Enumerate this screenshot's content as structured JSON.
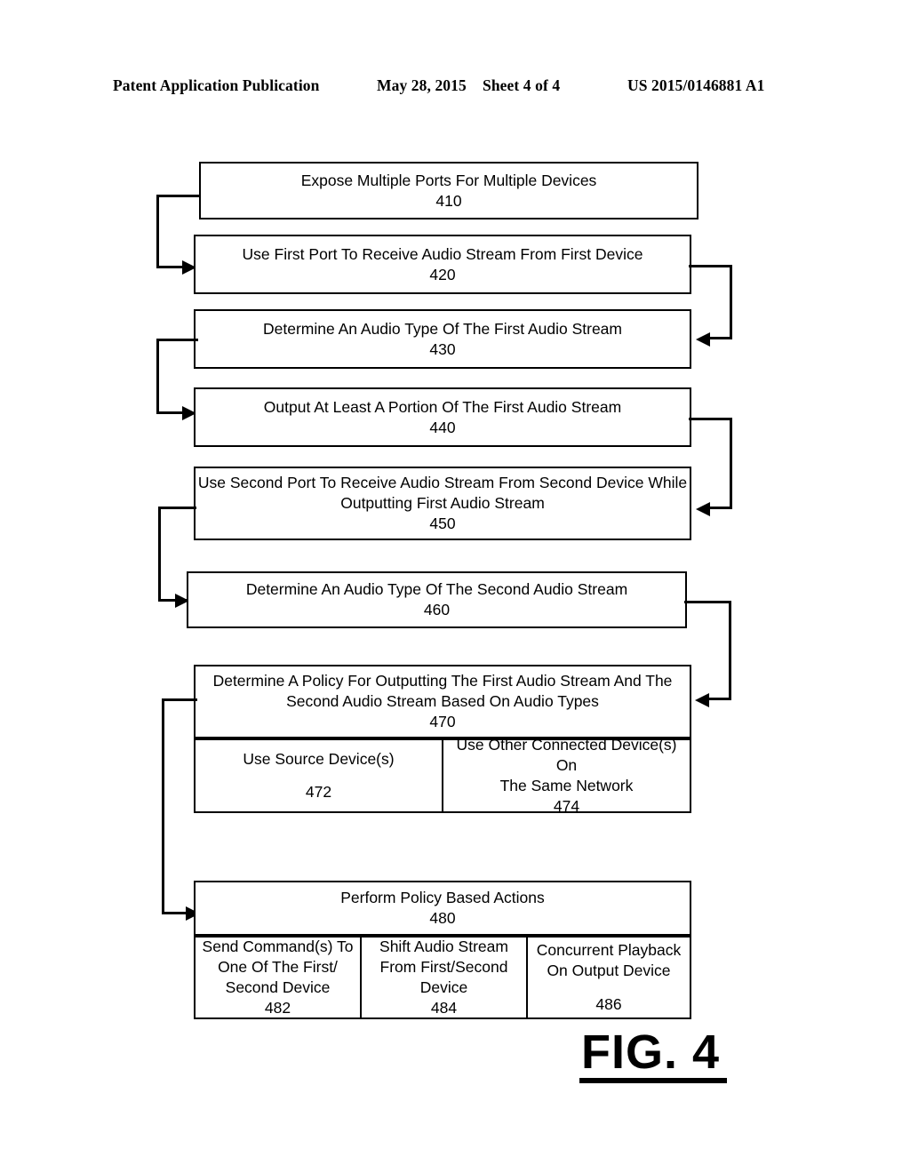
{
  "header": {
    "publication": "Patent Application Publication",
    "date": "May 28, 2015",
    "sheet": "Sheet 4 of 4",
    "publication_number": "US 2015/0146881 A1"
  },
  "figure": {
    "label": "FIG. 4",
    "caption_underlined": true
  },
  "colors": {
    "stroke": "#000000",
    "background": "#ffffff"
  },
  "flowchart": {
    "type": "process-flow",
    "steps": [
      {
        "id": "410",
        "name": "expose-ports",
        "lines": [
          "Expose Multiple Ports For Multiple Devices"
        ],
        "number": "410"
      },
      {
        "id": "420",
        "name": "first-port-receive",
        "lines": [
          "Use First Port To Receive Audio Stream From First Device"
        ],
        "number": "420"
      },
      {
        "id": "430",
        "name": "determine-first-audio-type",
        "lines": [
          "Determine An Audio Type Of The First Audio Stream"
        ],
        "number": "430"
      },
      {
        "id": "440",
        "name": "output-first-stream",
        "lines": [
          "Output At Least A Portion Of The First Audio Stream"
        ],
        "number": "440"
      },
      {
        "id": "450",
        "name": "second-port-receive",
        "lines": [
          "Use Second Port To Receive Audio Stream From Second Device While",
          "Outputting First Audio Stream"
        ],
        "number": "450"
      },
      {
        "id": "460",
        "name": "determine-second-audio-type",
        "lines": [
          "Determine An Audio Type Of The Second Audio Stream"
        ],
        "number": "460"
      },
      {
        "id": "470",
        "name": "determine-policy",
        "lines": [
          "Determine A Policy For Outputting The First Audio Stream And The",
          "Second Audio Stream Based On Audio Types"
        ],
        "number": "470",
        "substeps": [
          {
            "id": "472",
            "name": "use-source-devices",
            "lines": [
              "Use Source Device(s)"
            ],
            "number": "472"
          },
          {
            "id": "474",
            "name": "use-other-connected-devices",
            "lines": [
              "Use Other Connected Device(s) On",
              "The Same Network"
            ],
            "number": "474"
          }
        ]
      },
      {
        "id": "480",
        "name": "perform-policy-actions",
        "lines": [
          "Perform Policy Based Actions"
        ],
        "number": "480",
        "substeps": [
          {
            "id": "482",
            "name": "send-commands",
            "lines": [
              "Send Command(s) To",
              "One Of The First/",
              "Second Device"
            ],
            "number": "482"
          },
          {
            "id": "484",
            "name": "shift-audio-stream",
            "lines": [
              "Shift Audio Stream",
              "From First/Second",
              "Device"
            ],
            "number": "484"
          },
          {
            "id": "486",
            "name": "concurrent-playback",
            "lines": [
              "Concurrent Playback",
              "On Output Device"
            ],
            "number": "486"
          }
        ]
      }
    ],
    "connectors": [
      {
        "from": "410",
        "to": "420",
        "side": "left"
      },
      {
        "from": "420",
        "to": "430",
        "side": "right"
      },
      {
        "from": "430",
        "to": "440",
        "side": "left"
      },
      {
        "from": "440",
        "to": "450",
        "side": "right"
      },
      {
        "from": "450",
        "to": "460",
        "side": "left"
      },
      {
        "from": "460",
        "to": "470",
        "side": "right"
      },
      {
        "from": "470",
        "to": "480",
        "side": "left"
      }
    ]
  }
}
